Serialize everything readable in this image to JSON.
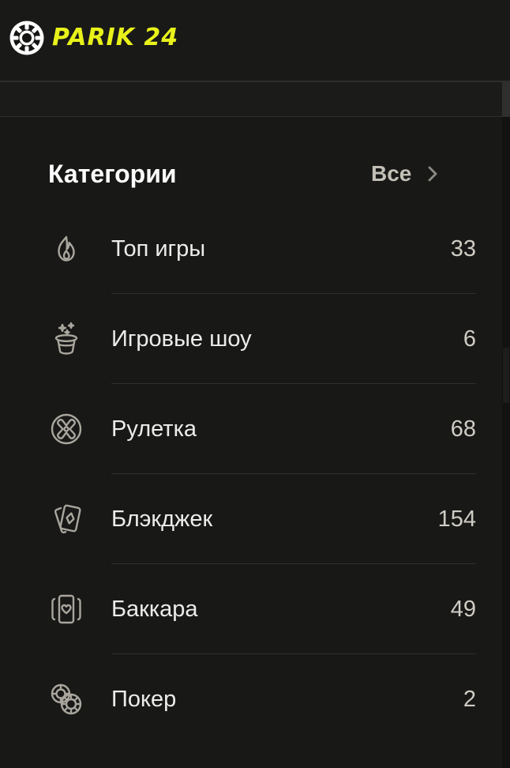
{
  "brand": {
    "name": "PARIK 24",
    "color": "#e8f21a"
  },
  "categories": {
    "title": "Категории",
    "all_label": "Все",
    "items": [
      {
        "icon": "flame-icon",
        "label": "Топ игры",
        "count": "33"
      },
      {
        "icon": "magic-hat-icon",
        "label": "Игровые шоу",
        "count": "6"
      },
      {
        "icon": "roulette-icon",
        "label": "Рулетка",
        "count": "68"
      },
      {
        "icon": "cards-icon",
        "label": "Блэкджек",
        "count": "154"
      },
      {
        "icon": "card-heart-icon",
        "label": "Баккара",
        "count": "49"
      },
      {
        "icon": "poker-chips-icon",
        "label": "Покер",
        "count": "2"
      }
    ]
  },
  "colors": {
    "background": "#181817",
    "text": "#ececea",
    "muted": "#cfccc4",
    "icon": "#a9a69d"
  }
}
